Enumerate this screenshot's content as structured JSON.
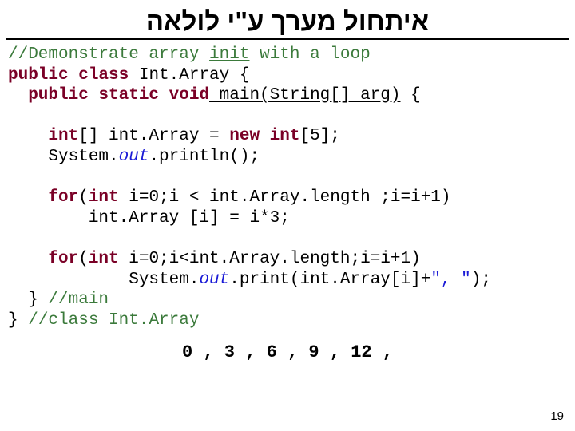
{
  "title": "איתחול מערך ע\"י לולאה",
  "code": {
    "c1": "//Demonstrate array ",
    "c1u": "init",
    "c1b": " with a loop",
    "k_pub1": "public class",
    "cls": " Int.Array {",
    "k_pub2": "  public static void",
    "main_u": " main(String[] arg)",
    "main_b": " {",
    "k_int": "    int",
    "decl_a": "[] int.Array = ",
    "k_new": "new int",
    "decl_b": "[5];",
    "sys1a": "    System.",
    "it_out1": "out",
    "sys1b": ".println();",
    "k_for1": "    for",
    "for1a": "(",
    "k_int2": "int",
    "for1b": " i=0;i < int.Array.length ;i=i+1)",
    "for1body": "        int.Array [i] = i*3;",
    "k_for2": "    for",
    "for2a": "(",
    "k_int3": "int",
    "for2b": " i=0;i<int.Array.length;i=i+1)",
    "sys2a": "            System.",
    "it_out2": "out",
    "sys2b": ".print(int.Array[i]+",
    "str": "\", \"",
    "sys2c": ");",
    "close1a": "  } ",
    "close1c": "//main",
    "close2a": "} ",
    "close2c": "//class Int.Array"
  },
  "output": "0 , 3 , 6 , 9 , 12 ,",
  "pageno": "19"
}
